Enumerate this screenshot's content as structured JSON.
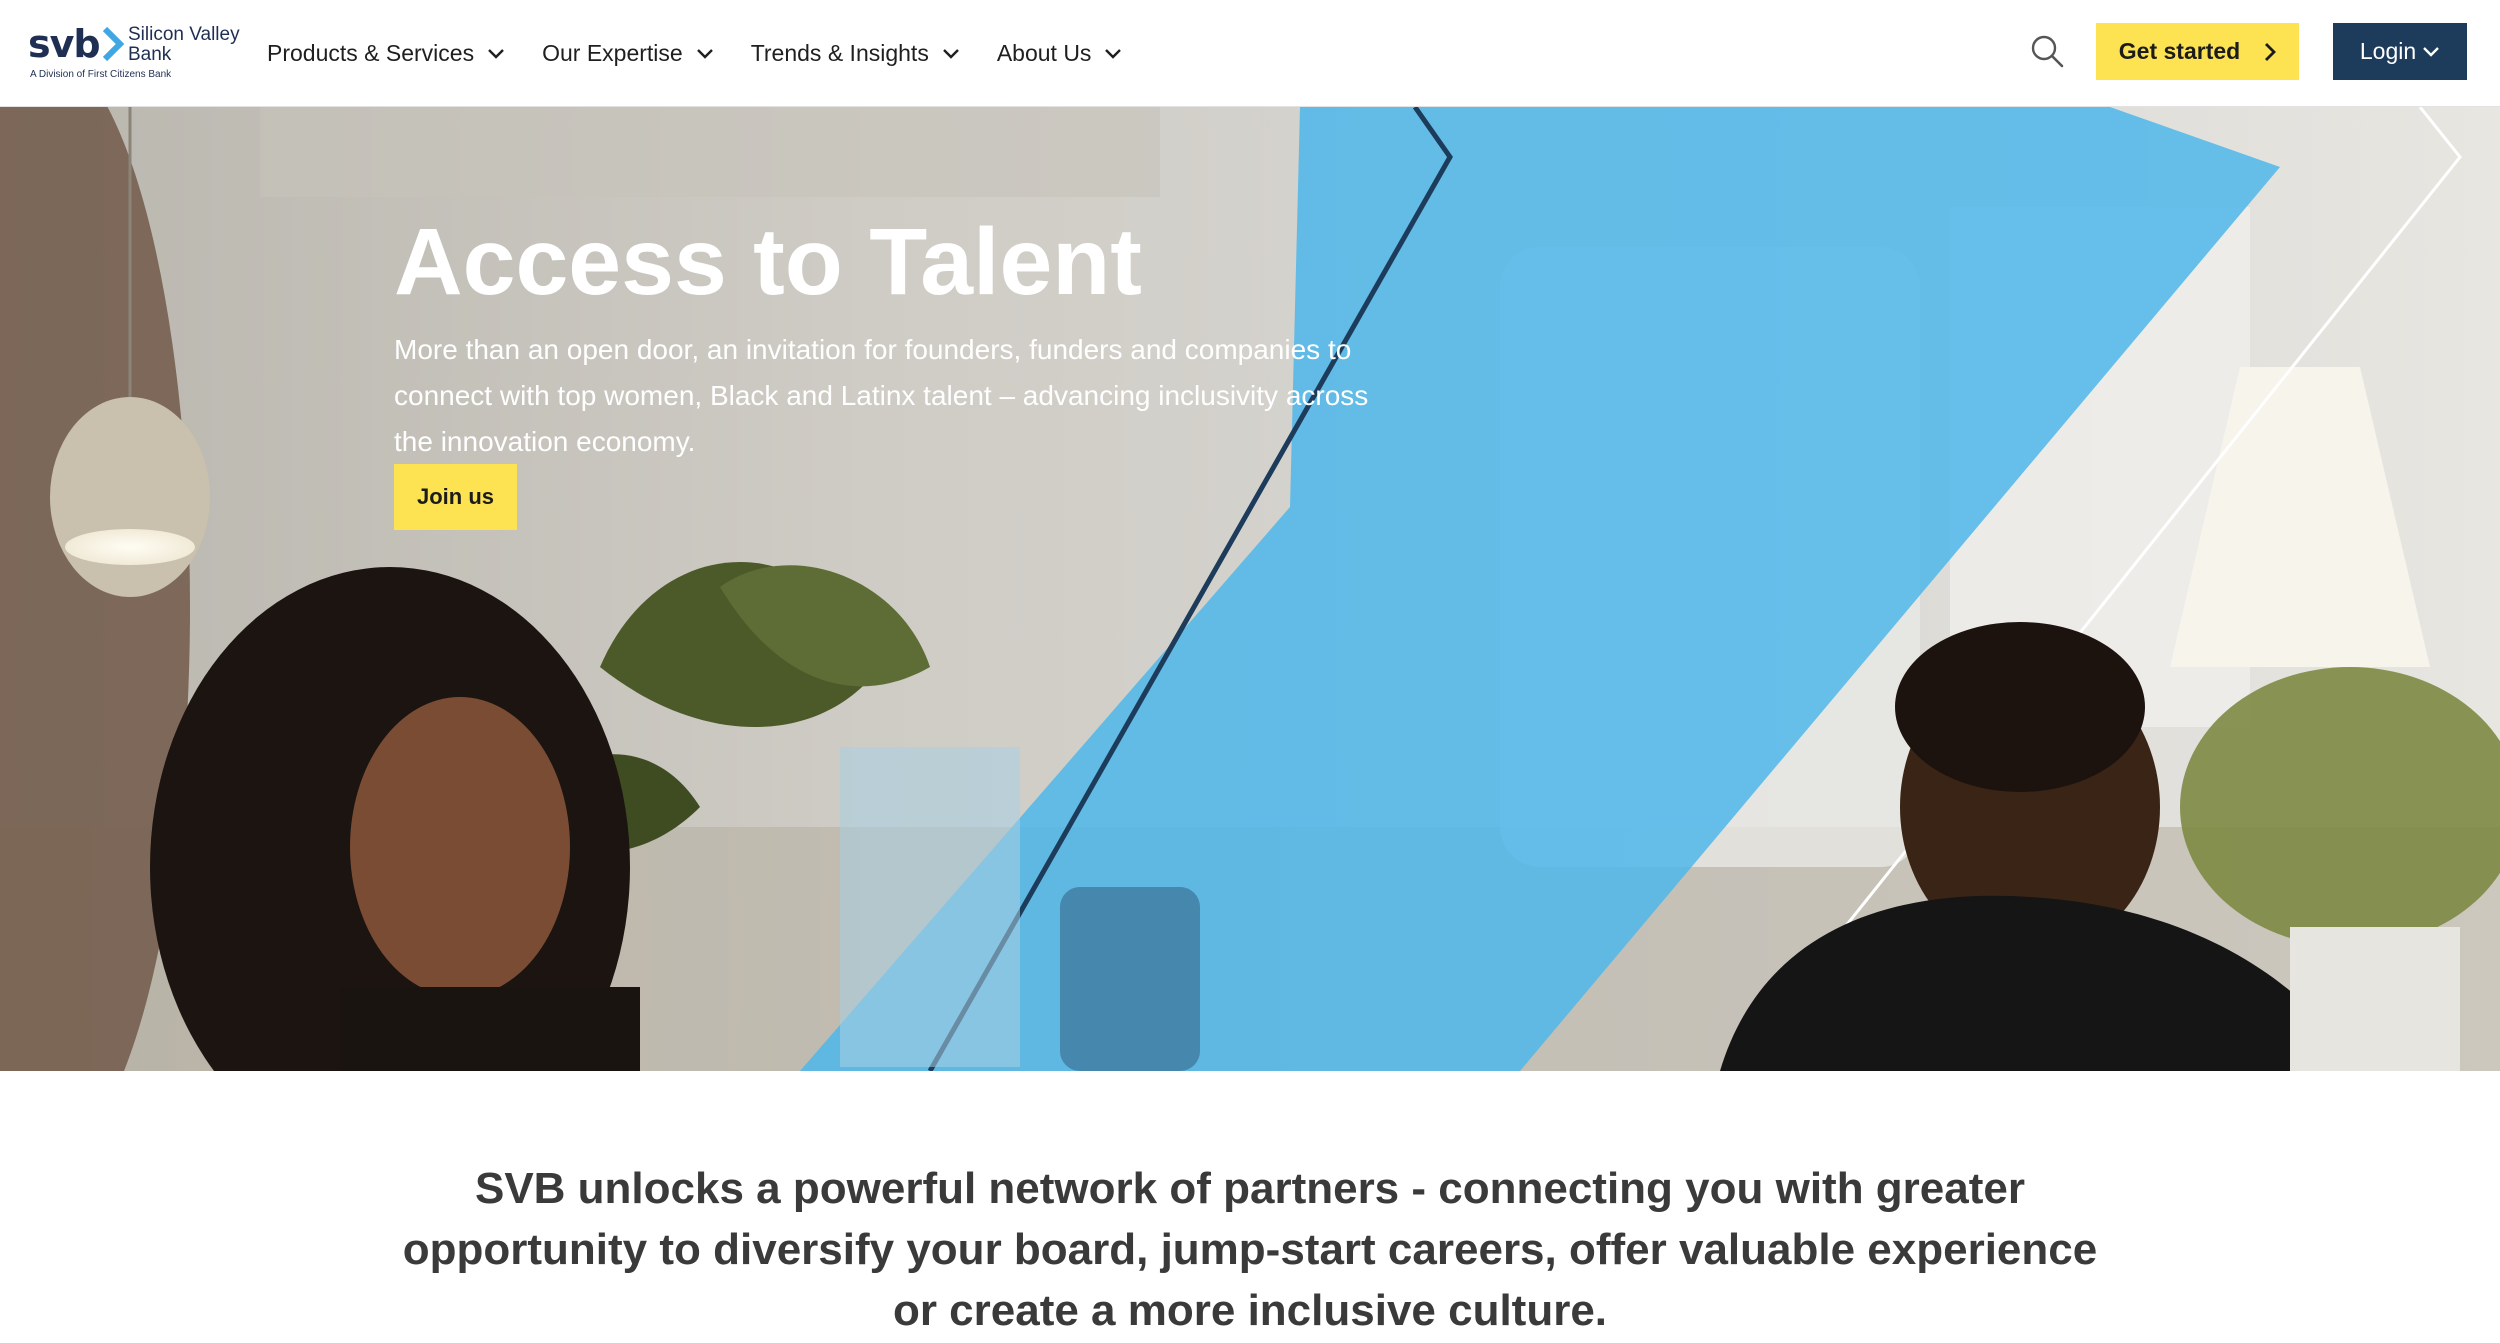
{
  "header": {
    "logo": {
      "mark": "svb",
      "name": "Silicon Valley Bank",
      "sub": "A Division of First Citizens Bank",
      "brand_color": "#1f2f54",
      "accent_color": "#3ea7e4"
    },
    "nav": [
      {
        "label": "Products & Services",
        "icon": "chevron-down-icon"
      },
      {
        "label": "Our Expertise",
        "icon": "chevron-down-icon"
      },
      {
        "label": "Trends & Insights",
        "icon": "chevron-down-icon"
      },
      {
        "label": "About Us",
        "icon": "chevron-down-icon"
      }
    ],
    "search_icon": "search-icon",
    "get_started": {
      "label": "Get started",
      "icon": "chevron-right-icon",
      "color": "#fde351"
    },
    "login": {
      "label": "Login",
      "icon": "chevron-down-icon",
      "color": "#1d3b5a"
    }
  },
  "hero": {
    "title": "Access to Talent",
    "text": "More than an open door, an invitation for founders, funders and companies to connect with top women, Black and Latinx talent – advancing inclusivity across the innovation economy.",
    "button": "Join us",
    "accent_color": "#4db7ea"
  },
  "intro": {
    "text": "SVB unlocks a powerful network of partners - connecting you with greater opportunity to diversify your board, jump-start careers, offer valuable experience or create a more inclusive culture."
  }
}
